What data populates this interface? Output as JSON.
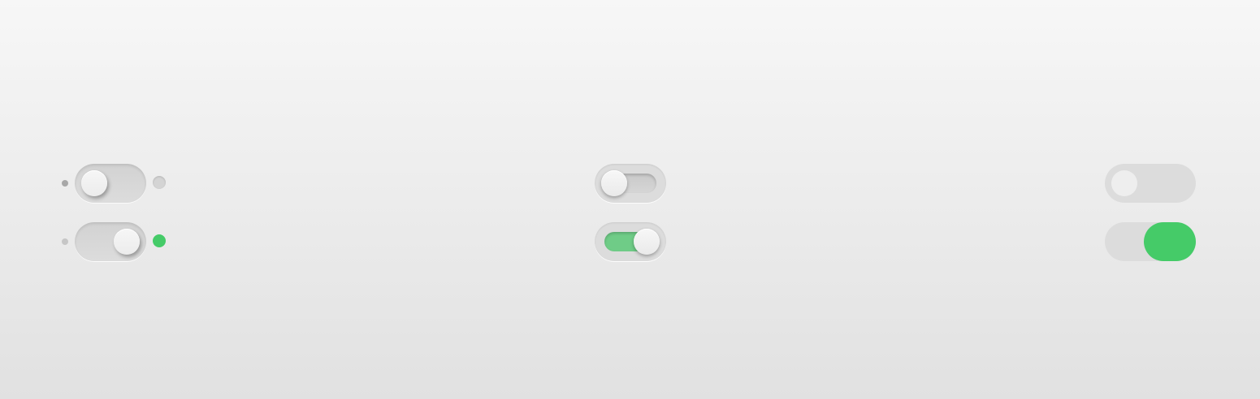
{
  "colors": {
    "on_accent": "#45cb68",
    "on_track_accent": "#6fcc87",
    "off_dot": "#a8a8a8",
    "off_dot_light": "#c6c6c6",
    "indicator_idle": "#d4d4d4"
  },
  "toggles": [
    {
      "style": "classic-with-indicators",
      "state": "off"
    },
    {
      "style": "classic-with-indicators",
      "state": "on"
    },
    {
      "style": "inset-track",
      "state": "off"
    },
    {
      "style": "inset-track",
      "state": "on"
    },
    {
      "style": "flat",
      "state": "off"
    },
    {
      "style": "flat",
      "state": "on"
    }
  ]
}
